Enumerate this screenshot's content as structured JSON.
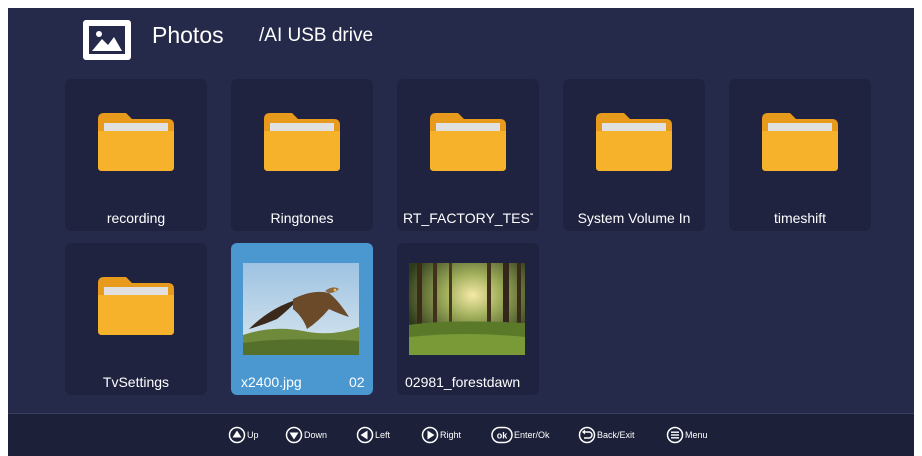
{
  "header": {
    "title": "Photos",
    "path": "/AI USB drive"
  },
  "grid": {
    "folders_row1": [
      {
        "name": "recording"
      },
      {
        "name": "Ringtones"
      },
      {
        "name": "RT_FACTORY_TEST"
      },
      {
        "name": "System Volume In"
      },
      {
        "name": "timeshift"
      }
    ],
    "folders_row2": [
      {
        "name": "TvSettings"
      }
    ],
    "files": [
      {
        "name": "x2400.jpg",
        "extra": "02",
        "selected": true,
        "thumbnail": "eagle-photo"
      },
      {
        "name": "02981_forestdawn",
        "selected": false,
        "thumbnail": "forest-photo"
      }
    ]
  },
  "footer": {
    "hints": [
      {
        "icon": "up-arrow-icon",
        "label": "Up"
      },
      {
        "icon": "down-arrow-icon",
        "label": "Down"
      },
      {
        "icon": "left-arrow-icon",
        "label": "Left"
      },
      {
        "icon": "right-arrow-icon",
        "label": "Right"
      },
      {
        "icon": "ok-icon",
        "label": "Enter/Ok",
        "glyph": "ok"
      },
      {
        "icon": "back-icon",
        "label": "Back/Exit"
      },
      {
        "icon": "menu-icon",
        "label": "Menu"
      }
    ]
  },
  "colors": {
    "background": "#262a4a",
    "tile": "#1f2340",
    "selected": "#4b98d1",
    "folder": "#f5b22a"
  }
}
